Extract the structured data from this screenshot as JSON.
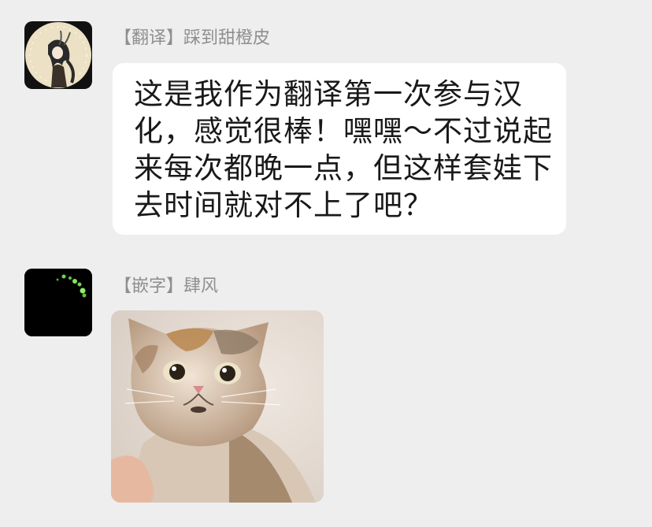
{
  "messages": [
    {
      "sender": "【翻译】踩到甜橙皮",
      "text": "这是我作为翻译第一次参与汉化，感觉很棒！嘿嘿～不过说起来每次都晚一点，但这样套娃下去时间就对不上了吧？"
    },
    {
      "sender": "【嵌字】肆风",
      "image": "cat-meme-sticker"
    }
  ],
  "colors": {
    "background": "#eeeeee",
    "bubble": "#ffffff",
    "sender_name": "#8f8f8f",
    "text": "#191919"
  }
}
